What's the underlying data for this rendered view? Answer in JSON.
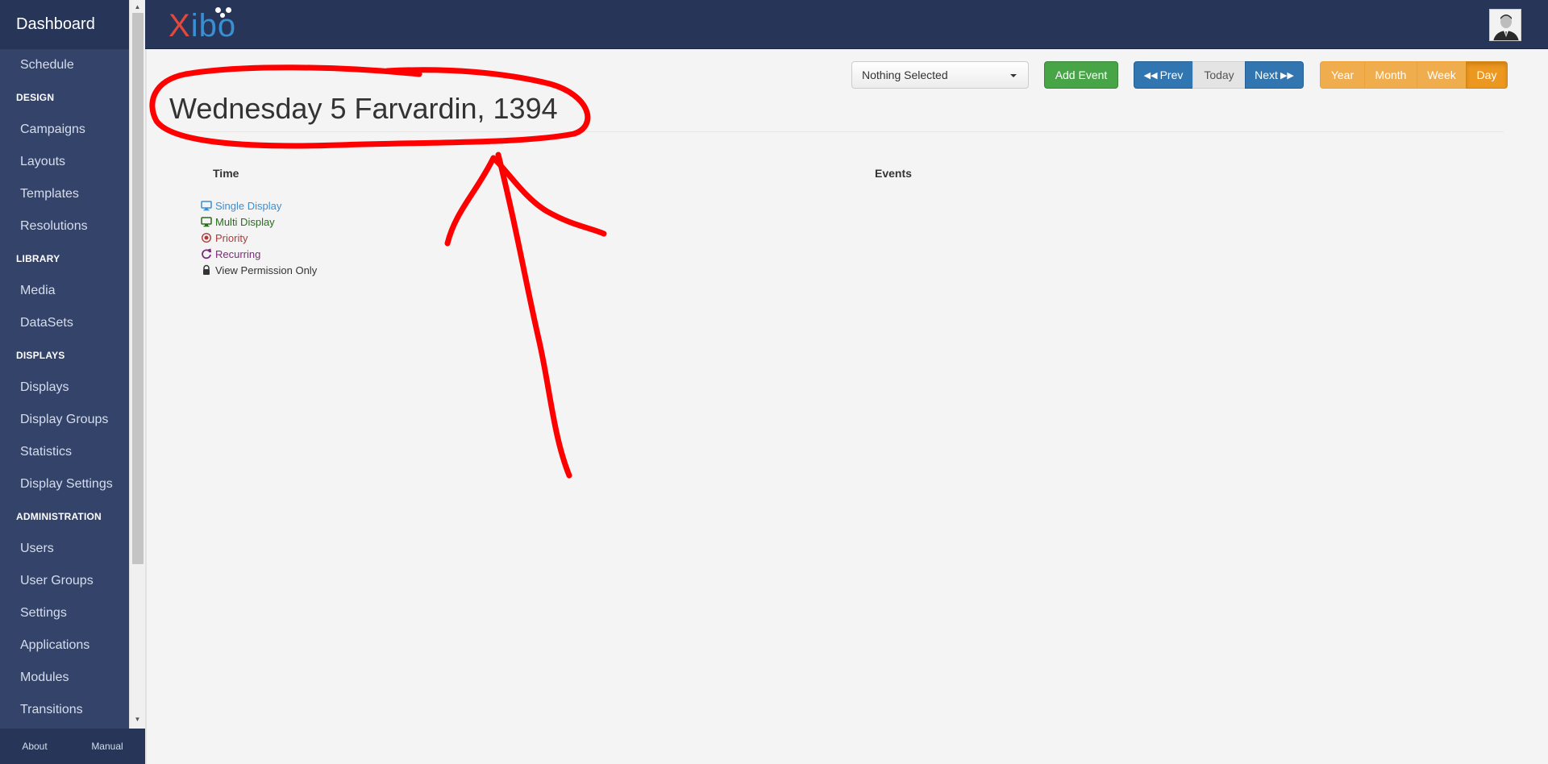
{
  "sidebar": {
    "header": "Dashboard",
    "items": [
      {
        "type": "item",
        "label": "Schedule"
      },
      {
        "type": "section",
        "label": "DESIGN"
      },
      {
        "type": "item",
        "label": "Campaigns"
      },
      {
        "type": "item",
        "label": "Layouts"
      },
      {
        "type": "item",
        "label": "Templates"
      },
      {
        "type": "item",
        "label": "Resolutions"
      },
      {
        "type": "section",
        "label": "LIBRARY"
      },
      {
        "type": "item",
        "label": "Media"
      },
      {
        "type": "item",
        "label": "DataSets"
      },
      {
        "type": "section",
        "label": "DISPLAYS"
      },
      {
        "type": "item",
        "label": "Displays"
      },
      {
        "type": "item",
        "label": "Display Groups"
      },
      {
        "type": "item",
        "label": "Statistics"
      },
      {
        "type": "item",
        "label": "Display Settings"
      },
      {
        "type": "section",
        "label": "ADMINISTRATION"
      },
      {
        "type": "item",
        "label": "Users"
      },
      {
        "type": "item",
        "label": "User Groups"
      },
      {
        "type": "item",
        "label": "Settings"
      },
      {
        "type": "item",
        "label": "Applications"
      },
      {
        "type": "item",
        "label": "Modules"
      },
      {
        "type": "item",
        "label": "Transitions"
      }
    ],
    "footer": {
      "about": "About",
      "manual": "Manual"
    }
  },
  "topbar": {
    "logo_x": "X",
    "logo_rest": "ibo"
  },
  "toolbar": {
    "select_value": "Nothing Selected",
    "add_event": "Add Event",
    "prev": "Prev",
    "today": "Today",
    "next": "Next",
    "year": "Year",
    "month": "Month",
    "week": "Week",
    "day": "Day"
  },
  "calendar": {
    "title": "Wednesday 5 Farvardin, 1394",
    "col_time": "Time",
    "col_events": "Events",
    "legend": [
      {
        "label": "Single Display",
        "icon": "monitor-icon",
        "color": "#3a8fd3"
      },
      {
        "label": "Multi Display",
        "icon": "monitor-icon",
        "color": "#2b6a1f"
      },
      {
        "label": "Priority",
        "icon": "bullseye-icon",
        "color": "#b03a3a"
      },
      {
        "label": "Recurring",
        "icon": "refresh-icon",
        "color": "#7b2b7b"
      },
      {
        "label": "View Permission Only",
        "icon": "lock-icon",
        "color": "#333333"
      }
    ]
  },
  "colors": {
    "sidebar": "#33436a",
    "topbar": "#263558",
    "primary": "#3276b1",
    "success": "#47a447",
    "warning": "#f0ad4e",
    "annotation": "#ff0000"
  }
}
